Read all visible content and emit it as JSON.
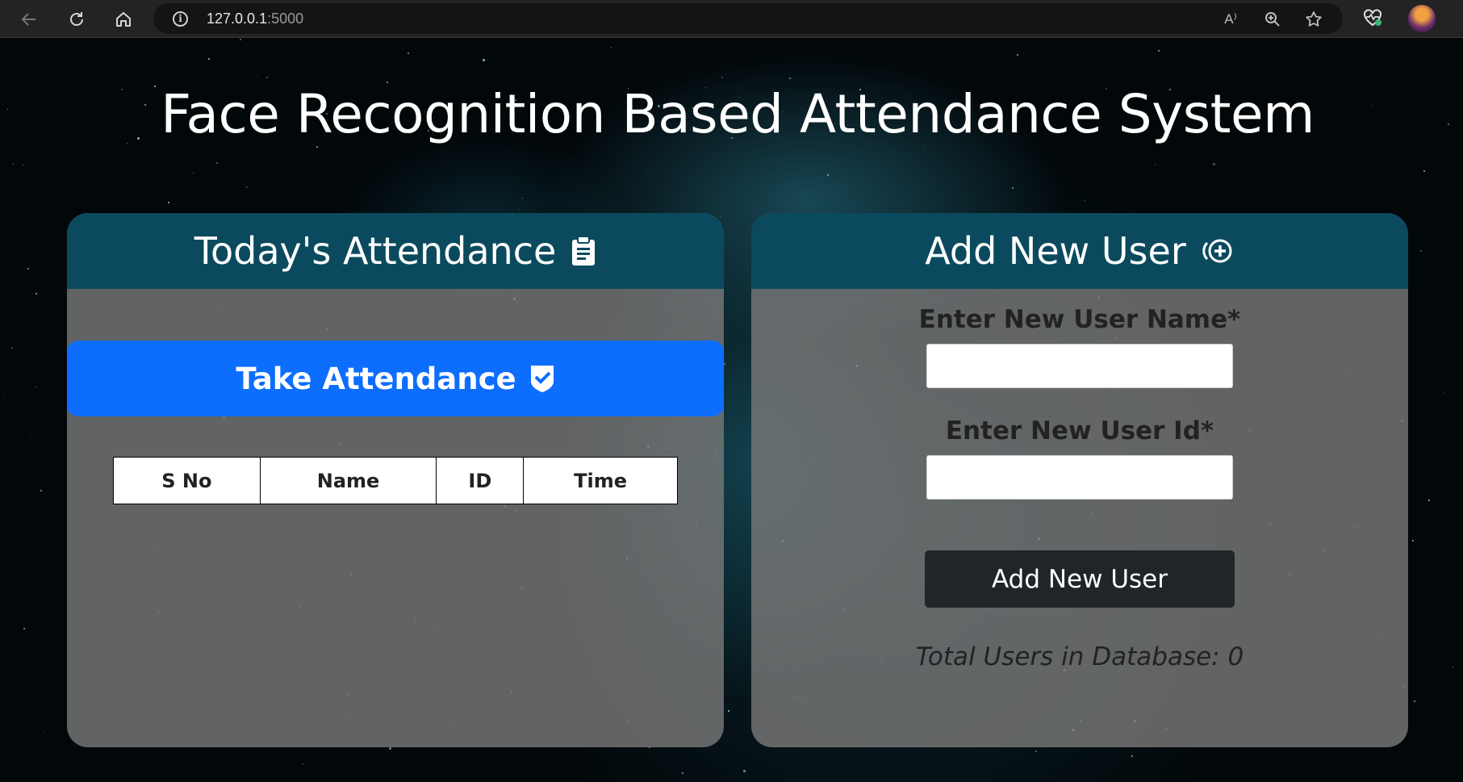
{
  "browser": {
    "url_host": "127.0.0.1",
    "url_port": ":5000",
    "read_aloud_label": "A⁾",
    "icons": [
      "back-icon",
      "reload-icon",
      "home-icon",
      "info-icon",
      "read-aloud-icon",
      "zoom-icon",
      "favorite-icon",
      "extension-icon",
      "profile-avatar"
    ]
  },
  "page": {
    "title": "Face Recognition Based Attendance System"
  },
  "attendance": {
    "header": "Today's Attendance",
    "header_icon": "clipboard-icon",
    "take_button": "Take Attendance",
    "take_button_icon": "shield-check-icon",
    "columns": [
      "S No",
      "Name",
      "ID",
      "Time"
    ],
    "rows": []
  },
  "add_user": {
    "header": "Add New User",
    "header_icon": "add-user-circle-icon",
    "name_label": "Enter New User Name*",
    "name_value": "",
    "id_label": "Enter New User Id*",
    "id_value": "",
    "submit_label": "Add New User",
    "total_text": "Total Users in Database: 0"
  },
  "colors": {
    "header_bg": "#0b4a5e",
    "primary_button": "#0d6efd",
    "dark_button": "#212529",
    "card_bg": "#787878"
  }
}
